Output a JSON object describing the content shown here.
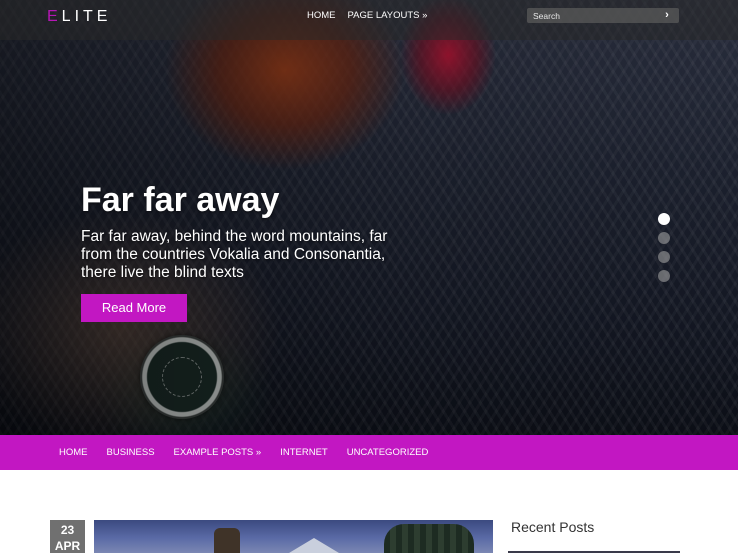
{
  "site": {
    "logo_first": "E",
    "logo_rest": "LITE"
  },
  "top_nav": {
    "items": [
      "HOME",
      "PAGE LAYOUTS »"
    ],
    "search_placeholder": "Search"
  },
  "slide": {
    "title": "Far far away",
    "text": "Far far away, behind the word mountains, far from the countries Vokalia and Consonantia, there live the blind texts",
    "button": "Read More",
    "slide_count": 4,
    "active_index": 0
  },
  "main_nav": {
    "items": [
      "HOME",
      "BUSINESS",
      "EXAMPLE POSTS »",
      "INTERNET",
      "UNCATEGORIZED"
    ]
  },
  "post": {
    "day": "23",
    "month": "APR"
  },
  "sidebar": {
    "title": "Recent Posts"
  },
  "colors": {
    "accent": "#c217c2",
    "date_badge": "#707070"
  },
  "icons": {
    "search_button": "chevron-right-icon"
  }
}
